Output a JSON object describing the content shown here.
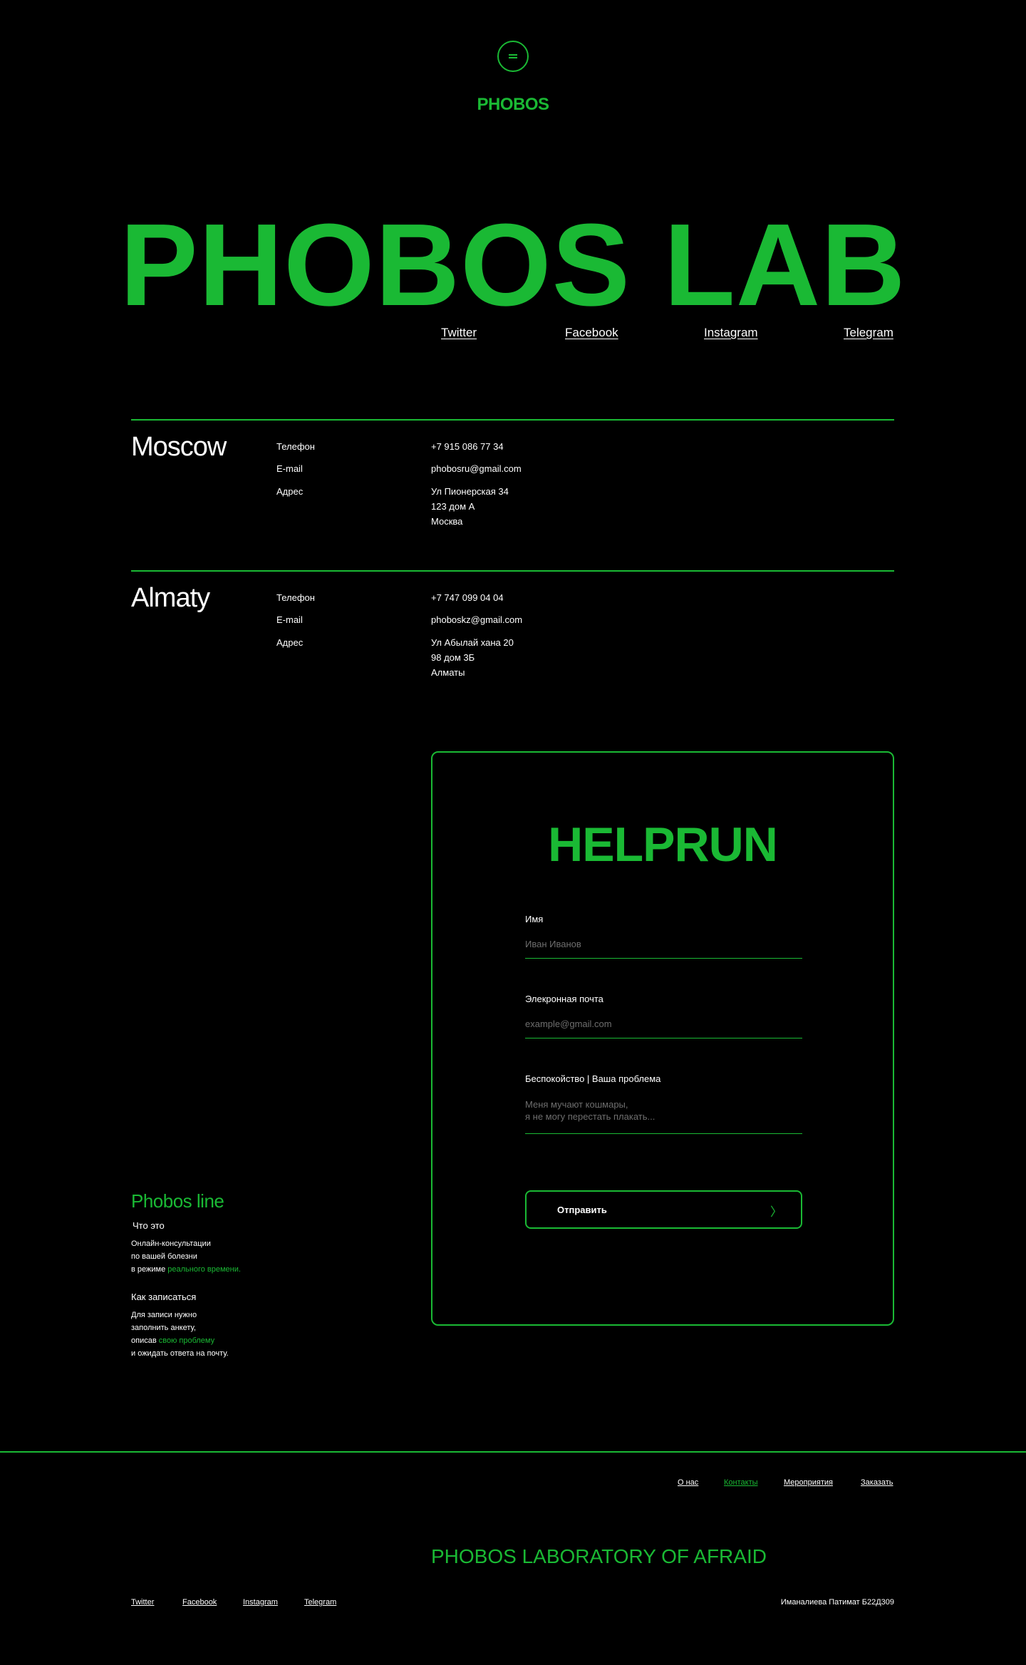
{
  "header": {
    "logo": "PHOBOS",
    "hero_title": "PHOBOS LAB",
    "social": [
      "Twitter",
      "Facebook",
      "Instagram",
      "Telegram"
    ]
  },
  "offices": [
    {
      "city": "Moscow",
      "phone_label": "Телефон",
      "phone": "+7 915 086 77 34",
      "email_label": "E-mail",
      "email": "phobosru@gmail.com",
      "address_label": "Адрес",
      "address": [
        "Ул Пионерская 34",
        "123 дом А",
        "Москва"
      ]
    },
    {
      "city": "Almaty",
      "phone_label": "Телефон",
      "phone": "+7 747 099 04 04",
      "email_label": "E-mail",
      "email": "phoboskz@gmail.com",
      "address_label": "Адрес",
      "address": [
        "Ул Абылай хана 20",
        "98 дом 3Б",
        "Алматы"
      ]
    }
  ],
  "form": {
    "title": "HELPRUN",
    "name_label": "Имя",
    "name_placeholder": "Иван Иванов",
    "email_label": "Элекронная почта",
    "email_placeholder": "example@gmail.com",
    "problem_label": "Беспокойство | Ваша проблема",
    "problem_placeholder": "Меня мучают кошмары,\nя не могу перестать плакать...",
    "submit": "Отправить",
    "submit_arrow": "〉"
  },
  "phobos_line": {
    "title": "Phobos line",
    "what_heading": "Что это",
    "what_lines": [
      "Онлайн-консультации",
      "по вашей болезни",
      "в режиме "
    ],
    "what_highlight": "реального времени.",
    "how_heading": "Как записаться",
    "how_lines": [
      "Для записи нужно",
      "заполнить анкету,",
      "описав "
    ],
    "how_highlight": "свою проблему",
    "how_last": "и ожидать ответа на почту."
  },
  "footer": {
    "nav": [
      "О нас",
      "Контакты",
      "Мероприятия",
      "Заказать"
    ],
    "active_nav": "Контакты",
    "title": "PHOBOS LABORATORY OF AFRAID",
    "social": [
      "Twitter",
      "Facebook",
      "Instagram",
      "Telegram"
    ],
    "credits": "Иманалиева Патимат Б22Д309"
  },
  "colors": {
    "accent": "#1ab934",
    "background": "#000000",
    "text": "#ffffff",
    "placeholder": "#6e6e6e"
  }
}
